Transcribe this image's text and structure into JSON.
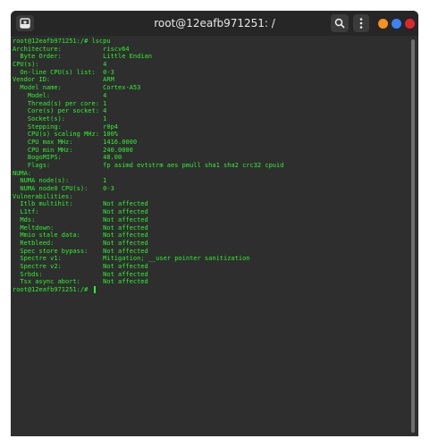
{
  "window": {
    "title": "root@12eafb971251: /",
    "new_tab_icon": "new-tab-icon",
    "search_icon": "search-icon",
    "menu_icon": "kebab-menu-icon",
    "controls": {
      "minimize_color": "#f6921e",
      "maximize_color": "#3b82f6",
      "close_color": "#e0262d"
    }
  },
  "terminal": {
    "text_color": "#2cf22c",
    "background_color": "#2e2e2e",
    "lines": [
      "root@12eafb971251:/# lscpu",
      "Architecture:           riscv64",
      "  Byte Order:           Little Endian",
      "CPU(s):                 4",
      "  On-line CPU(s) list:  0-3",
      "Vendor ID:              ARM",
      "  Model name:           Cortex-A53",
      "    Model:              4",
      "    Thread(s) per core: 1",
      "    Core(s) per socket: 4",
      "    Socket(s):          1",
      "    Stepping:           r0p4",
      "    CPU(s) scaling MHz: 100%",
      "    CPU max MHz:        1416.0000",
      "    CPU min MHz:        240.0000",
      "    BogoMIPS:           48.00",
      "    Flags:              fp asimd evtstrm aes pmull sha1 sha2 crc32 cpuid",
      "NUMA:",
      "  NUMA node(s):         1",
      "  NUMA node0 CPU(s):    0-3",
      "Vulnerabilities:",
      "  Itlb multihit:        Not affected",
      "  L1tf:                 Not affected",
      "  Mds:                  Not affected",
      "  Meltdown:             Not affected",
      "  Mmio stale data:      Not affected",
      "  Retbleed:             Not affected",
      "  Spec store bypass:    Not affected",
      "  Spectre v1:           Mitigation; __user pointer sanitization",
      "  Spectre v2:           Not affected",
      "  Srbds:                Not affected",
      "  Tsx async abort:      Not affected"
    ],
    "prompt": "root@12eafb971251:/# "
  }
}
